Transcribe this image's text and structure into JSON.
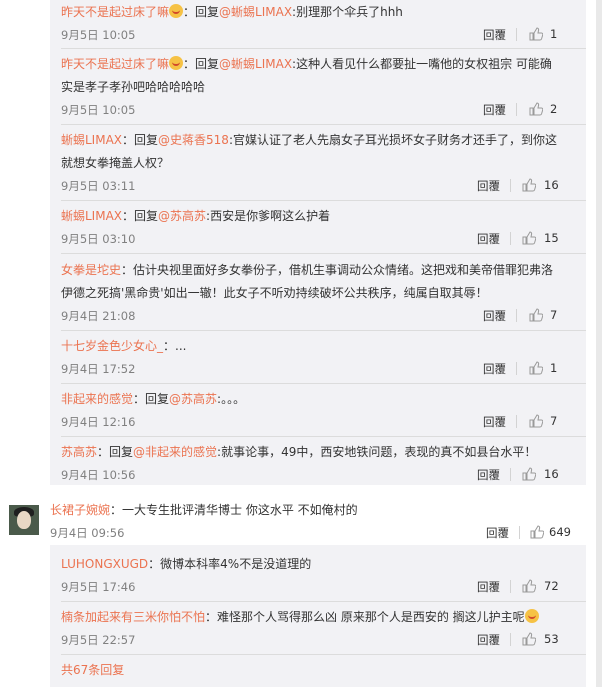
{
  "nested_comments": [
    {
      "author": "昨天不是起过床了嘛",
      "has_emoji": true,
      "reply_prefix": "：回复",
      "reply_to": "@蜥蜴LIMAX",
      "text_line1": ":别理那个伞兵了hhh",
      "text_line2": "",
      "date": "9月5日 10:05",
      "reply_label": "回覆",
      "likes": "1"
    },
    {
      "author": "昨天不是起过床了嘛",
      "has_emoji": true,
      "reply_prefix": "：回复",
      "reply_to": "@蜥蜴LIMAX",
      "text_line1": ":这种人看见什么都要扯一嘴他的女权祖宗 可能确",
      "text_line2": "实是孝子孝孙吧哈哈哈哈哈",
      "date": "9月5日 10:05",
      "reply_label": "回覆",
      "likes": "2"
    },
    {
      "author": "蜥蜴LIMAX",
      "reply_prefix": "：回复",
      "reply_to": "@史蒋香518",
      "text_line1": ":官媒认证了老人先扇女子耳光损坏女子财务才还手了，到你这",
      "text_line2": "就想女拳掩盖人权？",
      "date": "9月5日 03:11",
      "reply_label": "回覆",
      "likes": "16"
    },
    {
      "author": "蜥蜴LIMAX",
      "reply_prefix": "：回复",
      "reply_to": "@苏高苏",
      "text_line1": ":西安是你爹啊这么护着",
      "text_line2": "",
      "date": "9月5日 03:10",
      "reply_label": "回覆",
      "likes": "15"
    },
    {
      "author": "女拳是坨史",
      "reply_prefix": "",
      "reply_to": "",
      "text_line1": "：估计央视里面好多女拳份子，借机生事调动公众情绪。这把戏和美帝借罪犯弗洛",
      "text_line2": "伊德之死搞'黑命贵'如出一辙！此女子不听劝持续破坏公共秩序，纯属自取其辱！",
      "date": "9月4日 21:08",
      "reply_label": "回覆",
      "likes": "7"
    },
    {
      "author": "十七岁金色少女心_",
      "reply_prefix": "",
      "reply_to": "",
      "text_line1": "：...",
      "text_line2": "",
      "date": "9月4日 17:52",
      "reply_label": "回覆",
      "likes": "1"
    },
    {
      "author": "非起来的感觉",
      "reply_prefix": "：回复",
      "reply_to": "@苏高苏",
      "text_line1": ":。。。",
      "text_line2": "",
      "date": "9月4日 12:16",
      "reply_label": "回覆",
      "likes": "7"
    },
    {
      "author": "苏高苏",
      "reply_prefix": "：回复",
      "reply_to": "@非起来的感觉",
      "text_line1": ":就事论事，49中，西安地铁问题，表现的真不如县台水平！",
      "text_line2": "",
      "date": "9月4日 10:56",
      "reply_label": "回覆",
      "likes": "16"
    }
  ],
  "main_comment": {
    "author": "长裙子婉婉",
    "text": "：一大专生批评清华博士 你这水平 不如俺村的",
    "date": "9月4日 09:56",
    "reply_label": "回覆",
    "likes": "649"
  },
  "sub_replies": [
    {
      "author": "LUHONGXUGD",
      "text": "：微博本科率4%不是没道理的",
      "has_emoji": false,
      "date": "9月5日 17:46",
      "reply_label": "回覆",
      "likes": "72"
    },
    {
      "author": "楠条加起来有三米你怕不怕",
      "text": "：难怪那个人骂得那么凶 原来那个人是西安的 搁这儿护主呢",
      "has_emoji": true,
      "date": "9月5日 22:57",
      "reply_label": "回覆",
      "likes": "53"
    }
  ],
  "footer": {
    "more_replies": "共67条回复"
  },
  "colors": {
    "username": "#eb7350",
    "panel_bg": "#f2f2f5",
    "meta_text": "#808080"
  },
  "icons": [
    "thumbs-up-icon",
    "laughing-emoji-icon",
    "avatar-image"
  ]
}
